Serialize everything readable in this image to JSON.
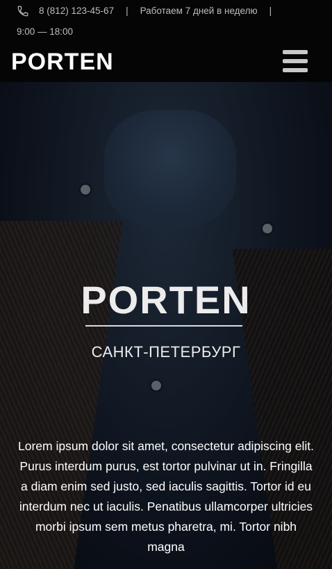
{
  "header": {
    "phone": "8 (812) 123-45-67",
    "separator": "|",
    "work_days": "Работаем 7 дней в неделю",
    "hours": "9:00 — 18:00",
    "logo": "PORTEN",
    "phone_icon": "phone-icon",
    "menu_icon": "hamburger-menu-icon"
  },
  "hero": {
    "logo": "PORTEN",
    "city": "САНКТ-ПЕТЕРБУРГ",
    "text": "Lorem ipsum dolor sit amet, consectetur adipiscing elit. Purus interdum purus, est tortor pulvinar ut in. Fringilla a diam enim sed justo, sed iaculis sagittis. Tortor id eu interdum nec ut iaculis. Penatibus ullamcorper ultricies morbi ipsum sem metus pharetra, mi. Tortor nibh magna"
  }
}
